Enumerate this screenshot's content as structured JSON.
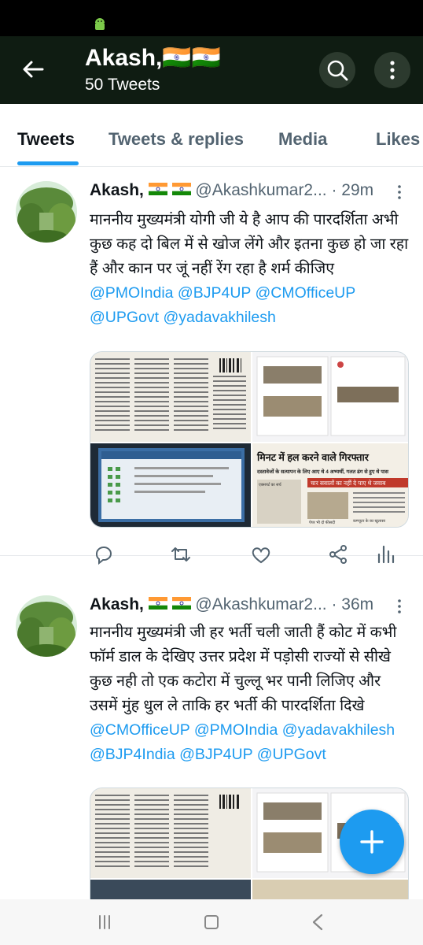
{
  "header": {
    "name": "Akash,🇮🇳🇮🇳",
    "tweet_count": "50 Tweets"
  },
  "tabs": [
    {
      "label": "Tweets"
    },
    {
      "label": "Tweets & replies"
    },
    {
      "label": "Media"
    },
    {
      "label": "Likes"
    }
  ],
  "tweets": [
    {
      "name": "Akash,",
      "handle": "@Akashkumar2...",
      "time": "29m",
      "text_plain": "माननीय मुख्यमंत्री योगी जी ये है आप की पारदर्शिता अभी कुछ कह दो बिल में से खोज लेंगे और इतना कुछ हो जा रहा हैं और कान पर जूं नहीं रेंग रहा है शर्म कीजिए ",
      "mentions": [
        "@PMOIndia",
        "@BJP4UP",
        "@CMOfficeUP",
        "@UPGovt",
        "@yadavakhilesh"
      ],
      "images": [
        {
          "caption": "मिनट में हल करने वाले गिरफ्तार"
        },
        {
          "caption": "दस्तावेजों के सत्यापन के लिए आए थे 4 अभ्यर्थी, गलत ढंग से हुए थे पास"
        },
        {
          "caption": "चार सवालों का नहीं दे पाए थे जवाब"
        },
        {
          "caption": "एक्सपर्ट का सर्च"
        },
        {
          "caption": "पेपर भी दो फीसदी"
        },
        {
          "caption": "कम्प्यूटर के का खुलासा"
        }
      ]
    },
    {
      "name": "Akash,",
      "handle": "@Akashkumar2...",
      "time": "36m",
      "text_plain": "माननीय मुख्यमंत्री जी हर भर्ती चली जाती हैं कोट में कभी फॉर्म डाल के देखिए उत्तर प्रदेश में पड़ोसी राज्यों से सीखे कुछ नही तो एक कटोरा में चुल्लू भर पानी लिजिए और उसमें मुंह धुल ले ताकि हर भर्ती की पारदर्शिता दिखे ",
      "mentions": [
        "@CMOfficeUP",
        "@PMOIndia",
        "@yadavakhilesh",
        "@BJP4India",
        "@BJP4UP",
        "@UPGovt"
      ]
    }
  ],
  "colors": {
    "accent": "#1d9bf0",
    "header_bg": "#0f1c12",
    "text": "#0f1419",
    "muted": "#536471"
  },
  "icons": [
    "back-arrow-icon",
    "search-icon",
    "more-vertical-icon",
    "reply-icon",
    "retweet-icon",
    "like-icon",
    "share-icon",
    "analytics-icon",
    "compose-plus-icon",
    "android-icon"
  ]
}
